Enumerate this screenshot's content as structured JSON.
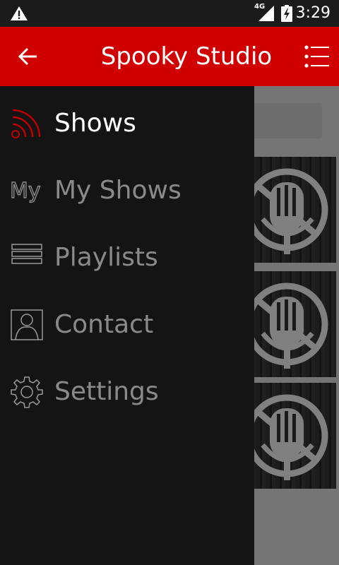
{
  "status_bar": {
    "network_type": "4G",
    "time": "3:29",
    "icons": [
      "warning-icon",
      "signal-icon",
      "battery-charging-icon"
    ]
  },
  "app_bar": {
    "title": "Spooky Studio",
    "back_icon": "arrow-left-icon",
    "menu_icon": "list-menu-icon",
    "color": "#d10000"
  },
  "drawer": {
    "items": [
      {
        "label": "Shows",
        "icon": "rss-feed-icon",
        "active": true
      },
      {
        "label": "My Shows",
        "icon": "my-text-icon",
        "icon_text": "My",
        "active": false
      },
      {
        "label": "Playlists",
        "icon": "list-lines-icon",
        "active": false
      },
      {
        "label": "Contact",
        "icon": "contact-person-icon",
        "active": false
      },
      {
        "label": "Settings",
        "icon": "gear-icon",
        "active": false
      }
    ]
  },
  "colors": {
    "accent": "#d10000",
    "drawer_bg": "#141414",
    "active_text": "#ffffff",
    "inactive_text": "#8a8a8a"
  }
}
